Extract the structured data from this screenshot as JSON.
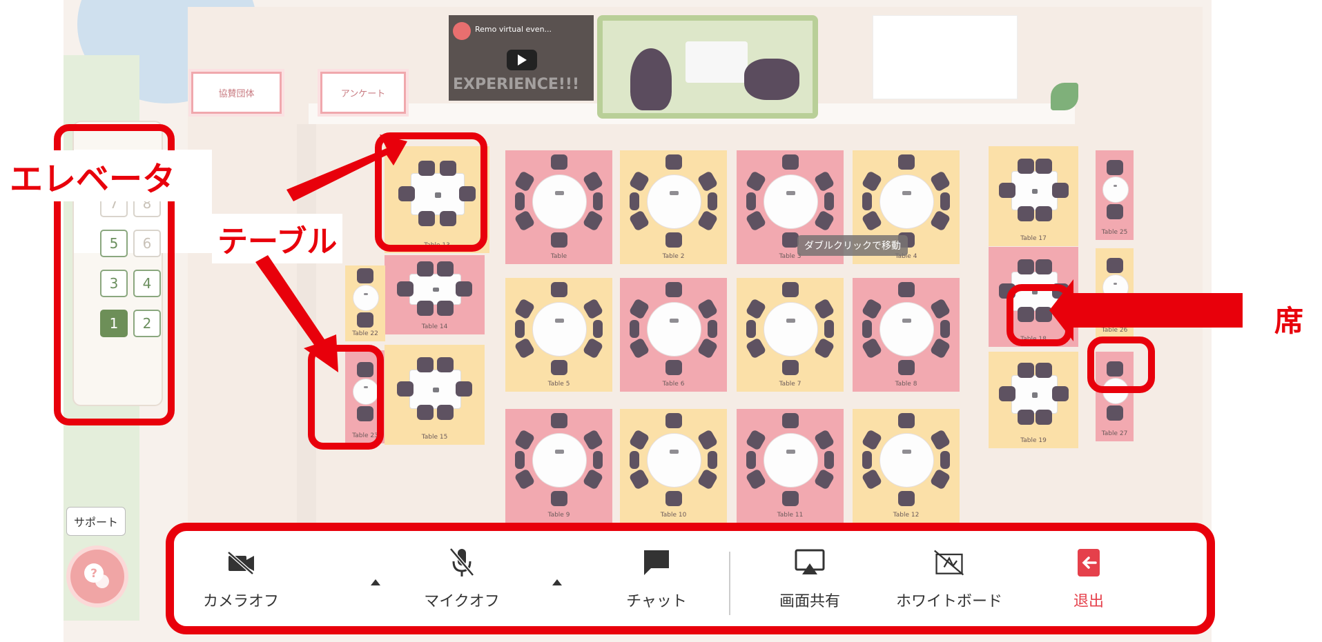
{
  "map": {
    "signs": {
      "sponsor": "協賛団体",
      "survey": "アンケート"
    },
    "video": {
      "title": "Remo virtual even...",
      "subtitle_big": "EXPERIENCE!!!"
    },
    "tooltip": "ダブルクリックで移動",
    "tables": [
      {
        "label": "Table 13",
        "color": "yellow"
      },
      {
        "label": "Table",
        "color": "red"
      },
      {
        "label": "Table 2",
        "color": "yellow"
      },
      {
        "label": "Table 3",
        "color": "red"
      },
      {
        "label": "Table 4",
        "color": "yellow"
      },
      {
        "label": "Table 17",
        "color": "yellow"
      },
      {
        "label": "Table 25",
        "color": "red"
      },
      {
        "label": "Table 14",
        "color": "red"
      },
      {
        "label": "Table 22",
        "color": "yellow"
      },
      {
        "label": "Table 5",
        "color": "yellow"
      },
      {
        "label": "Table 6",
        "color": "red"
      },
      {
        "label": "Table 7",
        "color": "yellow"
      },
      {
        "label": "Table 8",
        "color": "red"
      },
      {
        "label": "Table 18",
        "color": "red"
      },
      {
        "label": "Table 26",
        "color": "yellow"
      },
      {
        "label": "Table 23",
        "color": "red"
      },
      {
        "label": "Table 15",
        "color": "yellow"
      },
      {
        "label": "Table 9",
        "color": "red"
      },
      {
        "label": "Table 10",
        "color": "yellow"
      },
      {
        "label": "Table 11",
        "color": "red"
      },
      {
        "label": "Table 12",
        "color": "yellow"
      },
      {
        "label": "Table 19",
        "color": "yellow"
      },
      {
        "label": "Table 27",
        "color": "red"
      }
    ]
  },
  "elevator": {
    "buttons": [
      "7",
      "8",
      "5",
      "6",
      "3",
      "4",
      "1",
      "2"
    ],
    "active": "1"
  },
  "annotations": {
    "elevator": "エレベータ",
    "table": "テーブル",
    "seat": "席"
  },
  "support": {
    "label": "サポート"
  },
  "toolbar": {
    "camera": "カメラオフ",
    "mic": "マイクオフ",
    "chat": "チャット",
    "screen_share": "画面共有",
    "whiteboard": "ホワイトボード",
    "exit": "退出"
  },
  "colors": {
    "annotation_red": "#e8000b",
    "exit_red": "#e5404b",
    "elevator_green": "#6d8f58",
    "table_yellow": "#fbe0a8",
    "table_red": "#f2a9b0"
  }
}
